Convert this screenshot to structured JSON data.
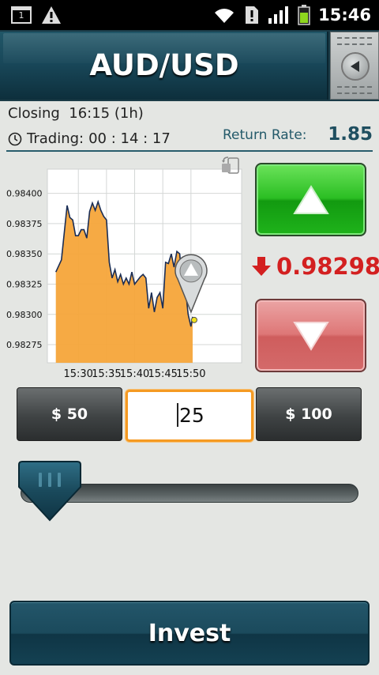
{
  "status_bar": {
    "time": "15:46",
    "calendar_day": "1",
    "icons": [
      "calendar-icon",
      "warning-icon",
      "wifi-icon",
      "sim-alert-icon",
      "signal-icon",
      "battery-icon"
    ]
  },
  "header": {
    "title": "AUD/USD",
    "back_icon": "back-arrow-icon"
  },
  "info": {
    "closing_label": "Closing",
    "closing_value": "16:15 (1h)",
    "trading_label": "Trading:",
    "trading_value": "00 : 14 : 17",
    "return_rate_label": "Return Rate:",
    "return_rate_value": "1.85"
  },
  "trade": {
    "current_price": "0.98298",
    "price_direction": "down",
    "up_icon": "arrow-up-icon",
    "down_icon": "arrow-down-icon"
  },
  "amounts": {
    "preset_low": "$ 50",
    "input_value": "25",
    "preset_high": "$ 100"
  },
  "slider": {
    "level": 0.0
  },
  "invest_label": "Invest",
  "colors": {
    "header": "#19485a",
    "up": "#2bbe23",
    "down": "#de7777",
    "price": "#d32020",
    "chart_fill": "#f5a53a",
    "chart_line": "#1a2d55",
    "accent": "#f59a22"
  },
  "chart_data": {
    "type": "area",
    "ylim": [
      0.9826,
      0.9842
    ],
    "yticks": [
      "0.98400",
      "0.98375",
      "0.98350",
      "0.98325",
      "0.98300",
      "0.98275"
    ],
    "xticks": [
      "15:30",
      "15:35",
      "15:40",
      "15:45",
      "15:50"
    ],
    "xrange_minutes": [
      15.2,
      15.85
    ],
    "series": [
      {
        "x": [
          "15:26",
          "15:27",
          "15:28",
          "15:28.5",
          "15:29",
          "15:29.5",
          "15:30",
          "15:30.5",
          "15:31",
          "15:31.5",
          "15:32",
          "15:32.5",
          "15:33",
          "15:33.5",
          "15:34",
          "15:34.5",
          "15:35",
          "15:35.5",
          "15:36",
          "15:36.5",
          "15:37",
          "15:37.5",
          "15:38",
          "15:38.5",
          "15:39",
          "15:39.5",
          "15:40",
          "15:40.5",
          "15:41",
          "15:41.5",
          "15:42",
          "15:42.5",
          "15:43",
          "15:43.5",
          "15:44",
          "15:44.5",
          "15:45",
          "15:45.5",
          "15:46",
          "15:46.5",
          "15:47",
          "15:47.5",
          "15:48",
          "15:48.5",
          "15:49",
          "15:49.5",
          "15:50",
          "15:50.3"
        ],
        "y": [
          0.98335,
          0.98345,
          0.9839,
          0.9838,
          0.98378,
          0.98365,
          0.98365,
          0.9837,
          0.9837,
          0.98363,
          0.98385,
          0.98392,
          0.98386,
          0.98393,
          0.98386,
          0.98381,
          0.98378,
          0.98343,
          0.9833,
          0.98337,
          0.98327,
          0.98333,
          0.98325,
          0.9833,
          0.98325,
          0.98335,
          0.98325,
          0.98328,
          0.98331,
          0.98333,
          0.9833,
          0.98305,
          0.98318,
          0.98302,
          0.98314,
          0.98318,
          0.98305,
          0.98343,
          0.98342,
          0.9835,
          0.98339,
          0.98352,
          0.9835,
          0.98322,
          0.98322,
          0.983,
          0.9829,
          0.98298
        ]
      }
    ],
    "grid": true
  }
}
